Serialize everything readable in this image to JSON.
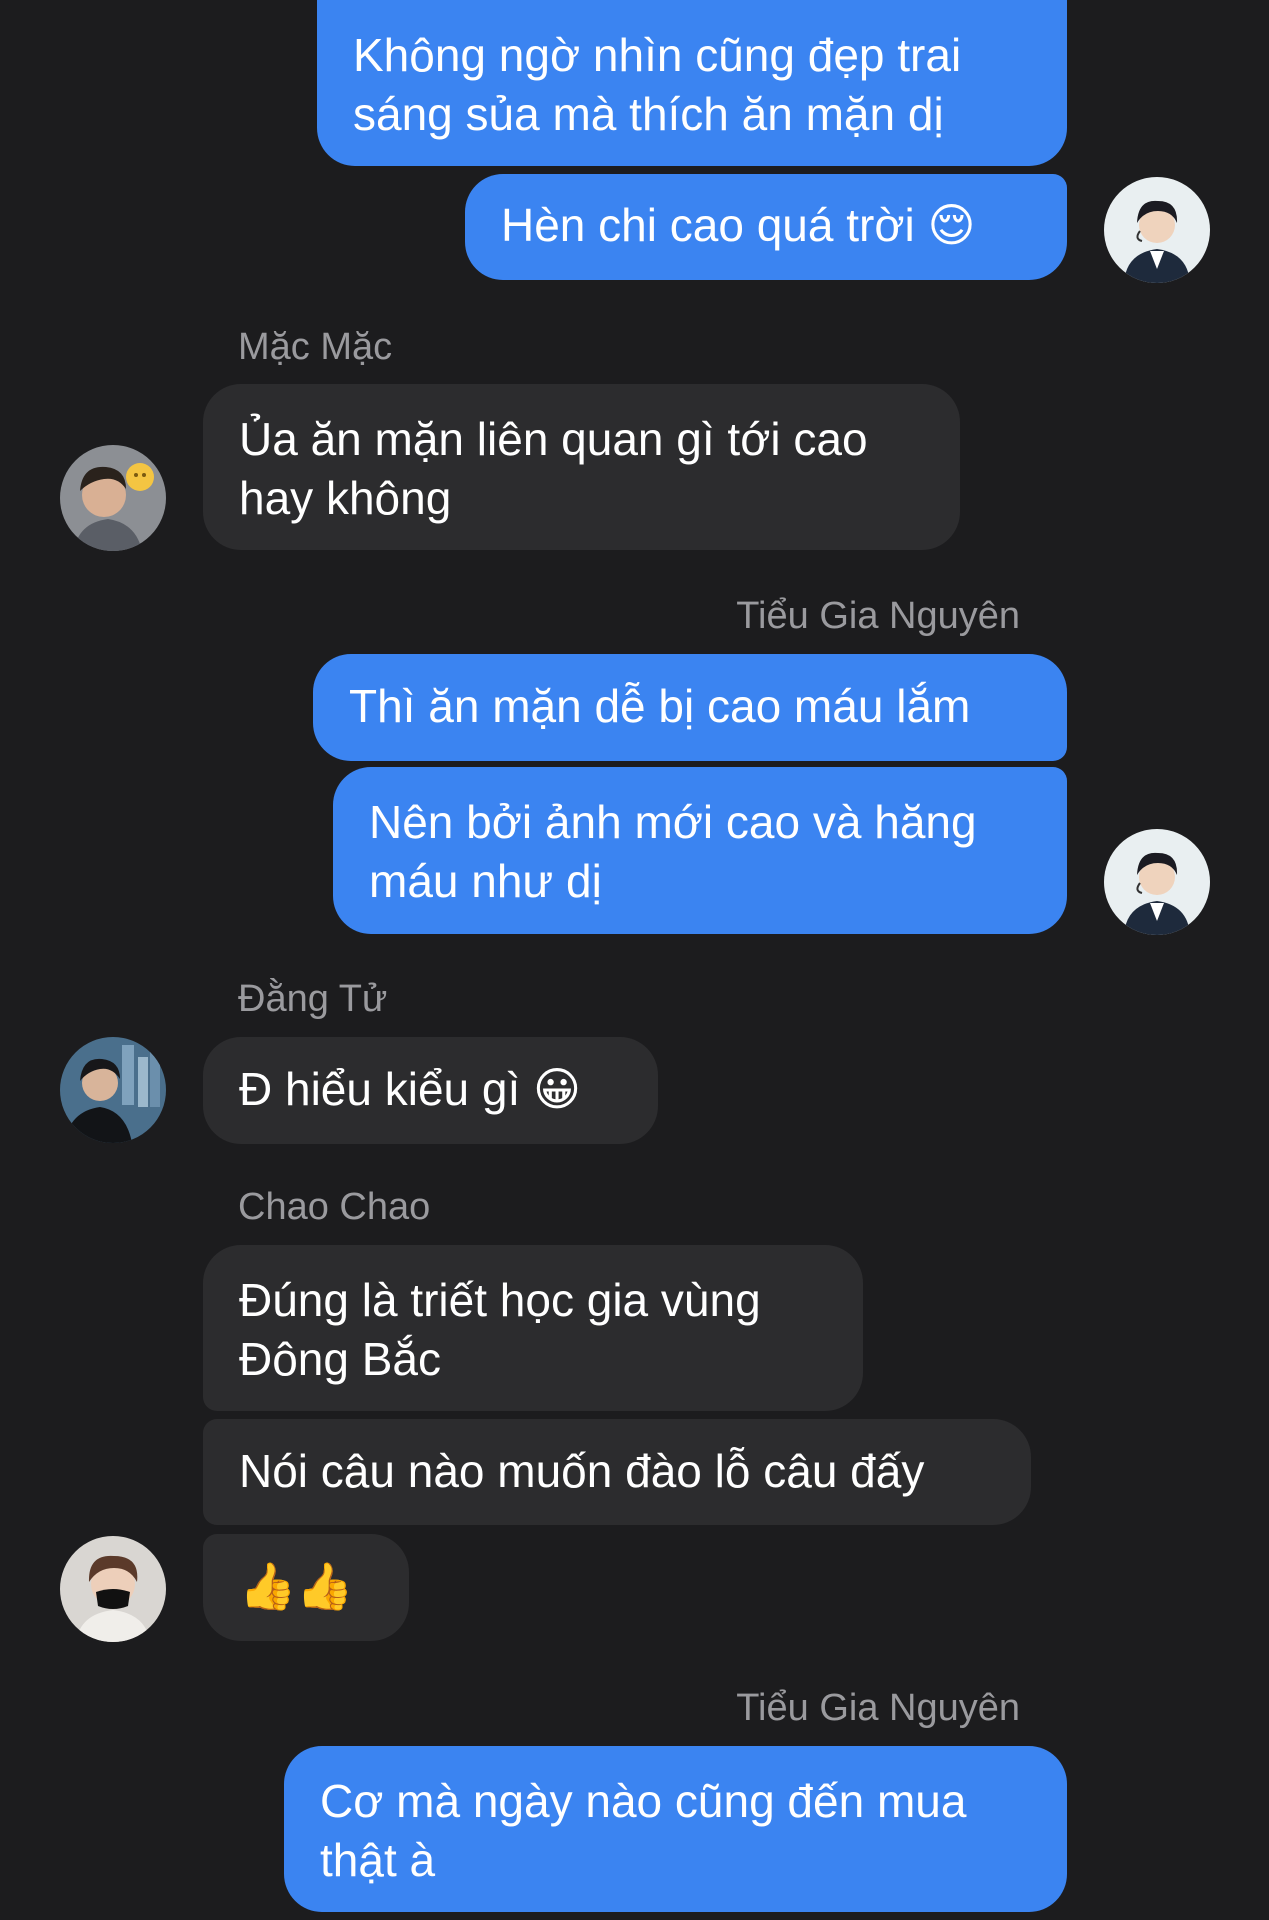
{
  "messages": [
    {
      "from": "me",
      "text": "Không ngờ nhìn cũng đẹp trai\nsáng sủa mà thích ăn mặn dị"
    },
    {
      "from": "me",
      "text": "Hèn chi cao quá trời 😌"
    },
    {
      "sender": "Mặc Mặc",
      "from": "other",
      "text": "Ủa ăn mặn liên quan gì tới cao\nhay không"
    },
    {
      "sender": "Tiểu Gia Nguyên",
      "from": "me",
      "text": "Thì ăn mặn dễ bị cao máu lắm"
    },
    {
      "from": "me",
      "text": "Nên bởi ảnh mới cao và hăng\nmáu như dị"
    },
    {
      "sender": "Đằng Tử",
      "from": "other",
      "text": "Đ hiểu kiểu gì 😀"
    },
    {
      "sender": "Chao Chao",
      "from": "other",
      "text": "Đúng là triết học gia vùng\nĐông Bắc"
    },
    {
      "from": "other",
      "text": "Nói câu nào muốn đào lỗ câu đấy"
    },
    {
      "from": "other",
      "text": "👍👍"
    },
    {
      "sender": "Tiểu Gia Nguyên",
      "from": "me",
      "text": "Cơ mà ngày nào cũng đến mua\nthật à"
    }
  ],
  "colors": {
    "background": "#1c1c1e",
    "outgoing_bubble": "#3b84f1",
    "incoming_bubble": "#2c2c2e",
    "sender_name": "#9a9a9e"
  }
}
